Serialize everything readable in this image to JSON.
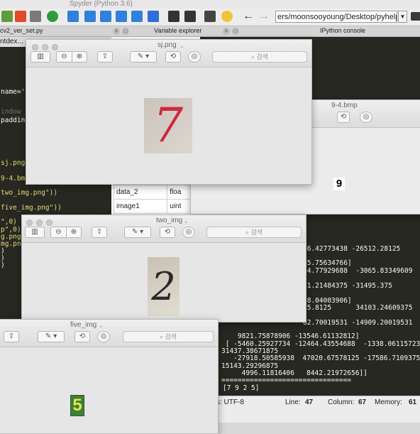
{
  "spyder": {
    "title": "Spyder (Python 3.6)",
    "path_value": "ers/moonsooyoung/Desktop/pyhelp",
    "panes": {
      "editor_label": "cv2_ver_set.py",
      "variable_explorer": "Variable explorer",
      "ipython_console": "IPython console"
    },
    "editor_tab": "ntdex...",
    "code_lines": [
      "name='c",
      "indow",
      "padding",
      "sj.png\"",
      "9-4.bmp",
      "two_img.png\"))",
      "five_img.png\"))",
      "\",0)",
      "p\",0)",
      "g.png\"",
      "mg.png",
      ")",
      ")",
      ")"
    ],
    "variables": [
      {
        "name": "data_2",
        "type": "floa"
      },
      {
        "name": "image1",
        "type": "uint"
      }
    ],
    "console_lines": [
      "26.42773438 -26512.28125",
      "15.75634766]",
      "54.77929688  -3065.83349609",
      "31.21484375 -31495.375",
      "68.04003906]",
      "25.8125      34103.24609375",
      "62.70019531 -14909.20019531",
      "    9821.75878906 -13546.61132812]",
      " [ -5460.25927734 -12464.43554688  -1338.06115723",
      "31437.38671875",
      "   -27918.50585938  47020.67578125 -17586.7109375",
      "15143.29296875",
      "     4996.11816406   8442.21972656]]",
      "[7 9 2 5]"
    ],
    "console_separator": "================================",
    "status": {
      "encoding": "ys: UTF-8",
      "line_label": "Line:",
      "line_value": "47",
      "column_label": "Column:",
      "column_value": "67",
      "memory_label": "Memory:",
      "memory_value": "61"
    }
  },
  "preview_windows": [
    {
      "title": "sj.png",
      "digit": "7",
      "search_placeholder": "검색"
    },
    {
      "title": "9-4.bmp",
      "digit": "9"
    },
    {
      "title": "two_img",
      "digit": "2",
      "search_placeholder": "검색"
    },
    {
      "title": "five_img",
      "digit": "5",
      "search_placeholder": "검색"
    }
  ],
  "colors": {
    "editor_bg": "#272822",
    "console_bg": "#272822",
    "digit7_ink": "#d0283c",
    "digit5_fill": "#e9e34a",
    "digit5_bg": "#3d7f3b"
  }
}
